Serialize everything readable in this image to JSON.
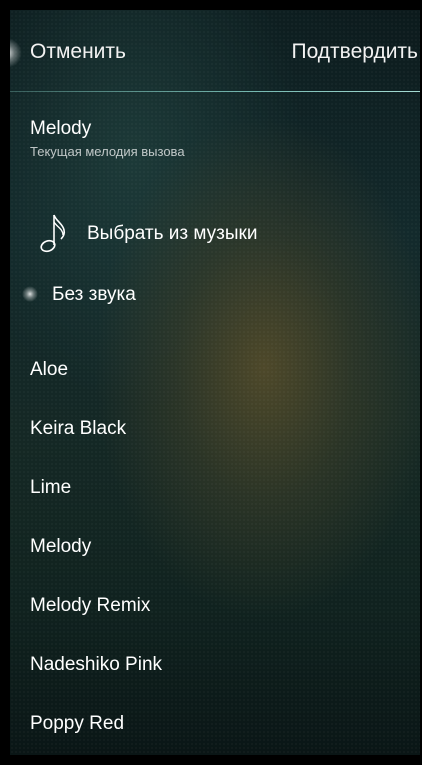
{
  "header": {
    "cancel_label": "Отменить",
    "confirm_label": "Подтвердить"
  },
  "current_ringtone": {
    "title": "Melody",
    "subtitle": "Текущая мелодия вызова"
  },
  "actions": {
    "pick_from_music": "Выбрать из музыки",
    "pick_from_music_icon": "music-note-icon",
    "silent": "Без звука"
  },
  "ringtones": [
    "Aloe",
    "Keira Black",
    "Lime",
    "Melody",
    "Melody Remix",
    "Nadeshiko Pink",
    "Poppy Red"
  ],
  "colors": {
    "text": "#ffffff",
    "accent_divider": "#8cdcd2",
    "background_dark": "#0c1a1c",
    "background_warm": "#584e2a"
  }
}
